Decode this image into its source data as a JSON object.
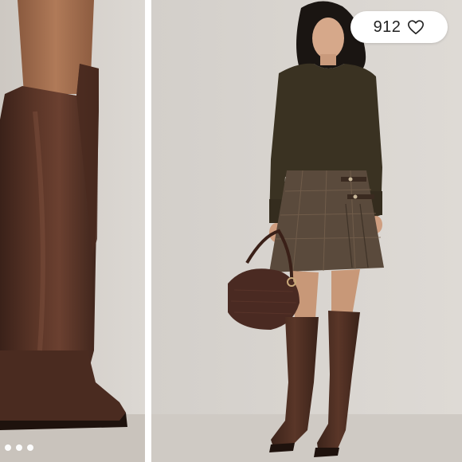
{
  "listing": {
    "like_count": "912",
    "heart_icon": "heart-outline-icon",
    "carousel": {
      "total_dots": 3,
      "active_index": 0
    },
    "images": [
      {
        "name": "boot-closeup-photo",
        "alt": ""
      },
      {
        "name": "full-outfit-photo",
        "alt": ""
      }
    ]
  },
  "colors": {
    "background": "#ffffff",
    "leather": "#4a2d22",
    "sweater": "#3b3222",
    "skirt": "#5a4a3c"
  }
}
